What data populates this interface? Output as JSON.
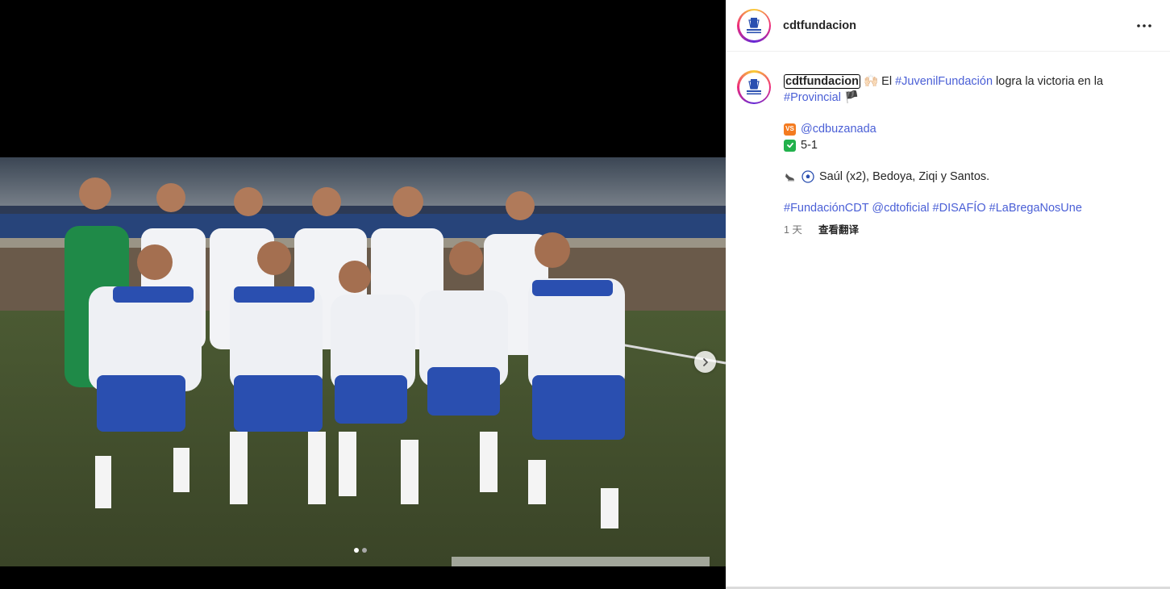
{
  "post": {
    "username": "cdtfundacion",
    "avatar_label": "FUNDACIÓN CD TENERIFE",
    "caption": {
      "emoji_hands": "🙌🏻",
      "intro_text": "El",
      "tag_juvenil": "#JuvenilFundación",
      "mid_text": "logra la victoria en la",
      "tag_provincial": "#Provincial",
      "flag_emoji": "🏴",
      "vs_label": "VS",
      "opponent": "@cdbuzanada",
      "score": "5-1",
      "scorers": "Saúl (x2), Bedoya, Ziqi y Santos.",
      "hashtags": [
        "#FundaciónCDT",
        "@cdtoficial",
        "#DISAFÍO",
        "#LaBregaNosUne"
      ]
    },
    "time_ago": "1 天",
    "translate_label": "查看翻译",
    "carousel": {
      "current_index": 1,
      "total": 2
    }
  },
  "icons": {
    "more": "more-horizontal-icon",
    "next": "chevron-right-icon",
    "vs": "vs-square-icon",
    "check": "check-mark-button-icon",
    "cleat": "soccer-cleat-icon",
    "ball": "soccer-ball-icon"
  },
  "colors": {
    "link_blue": "#4a5fd6",
    "jersey_blue": "#2a4fb0",
    "vs_orange": "#f47b20",
    "check_green": "#22b14c"
  }
}
